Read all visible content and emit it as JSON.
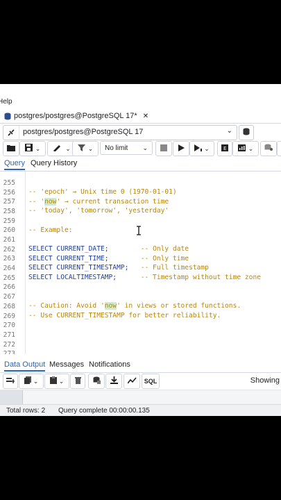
{
  "menu": {
    "help_label": "Help"
  },
  "tab": {
    "title": "postgres/postgres@PostgreSQL 17*",
    "close": "✕"
  },
  "connection": {
    "label": "postgres/postgres@PostgreSQL 17"
  },
  "toolbar": {
    "limit_label": "No limit"
  },
  "query_tabs": [
    {
      "label": "Query"
    },
    {
      "label": "Query History"
    }
  ],
  "editor": {
    "lines": [
      {
        "num": "255",
        "text": "-- 'epoch' → Unix time 0 (1970-01-01)"
      },
      {
        "num": "256",
        "text_a": "-- '",
        "text_hl": "now",
        "text_b": "' → current transaction time"
      },
      {
        "num": "257",
        "text": "-- 'today', 'tomorrow', 'yesterday'"
      },
      {
        "num": "258",
        "text": ""
      },
      {
        "num": "259",
        "text": "-- Example:"
      },
      {
        "num": "260",
        "text": ""
      },
      {
        "num": "261",
        "code": "SELECT CURRENT_DATE;",
        "pad": "        ",
        "comment": "-- Only date"
      },
      {
        "num": "262",
        "code": "SELECT CURRENT_TIME;",
        "pad": "        ",
        "comment": "-- Only time"
      },
      {
        "num": "263",
        "code": "SELECT CURRENT_TIMESTAMP;",
        "pad": "   ",
        "comment": "-- Full timestamp"
      },
      {
        "num": "264",
        "code": "SELECT LOCALTIMESTAMP;",
        "pad": "      ",
        "comment": "-- Timestamp without time zone"
      },
      {
        "num": "265",
        "text": ""
      },
      {
        "num": "266",
        "text": ""
      },
      {
        "num": "267",
        "text_a": "-- Caution: Avoid '",
        "text_hl": "now",
        "text_b": "' in views or stored functions."
      },
      {
        "num": "268",
        "text": "-- Use CURRENT_TIMESTAMP for better reliability."
      },
      {
        "num": "269",
        "text": ""
      },
      {
        "num": "270",
        "text": ""
      },
      {
        "num": "271",
        "text": ""
      },
      {
        "num": "272",
        "text": ""
      },
      {
        "num": "273",
        "text": ""
      }
    ]
  },
  "result_tabs": [
    {
      "label": "Data Output"
    },
    {
      "label": "Messages"
    },
    {
      "label": "Notifications"
    }
  ],
  "results": {
    "showing_label": "Showing"
  },
  "status": {
    "total_rows": "Total rows: 2",
    "query_complete": "Query complete 00:00:00.135"
  },
  "colors": {
    "accent": "#2a66b5",
    "comment": "#b8860b",
    "keyword": "#1f3d99",
    "highlight": "#cdeccf"
  }
}
